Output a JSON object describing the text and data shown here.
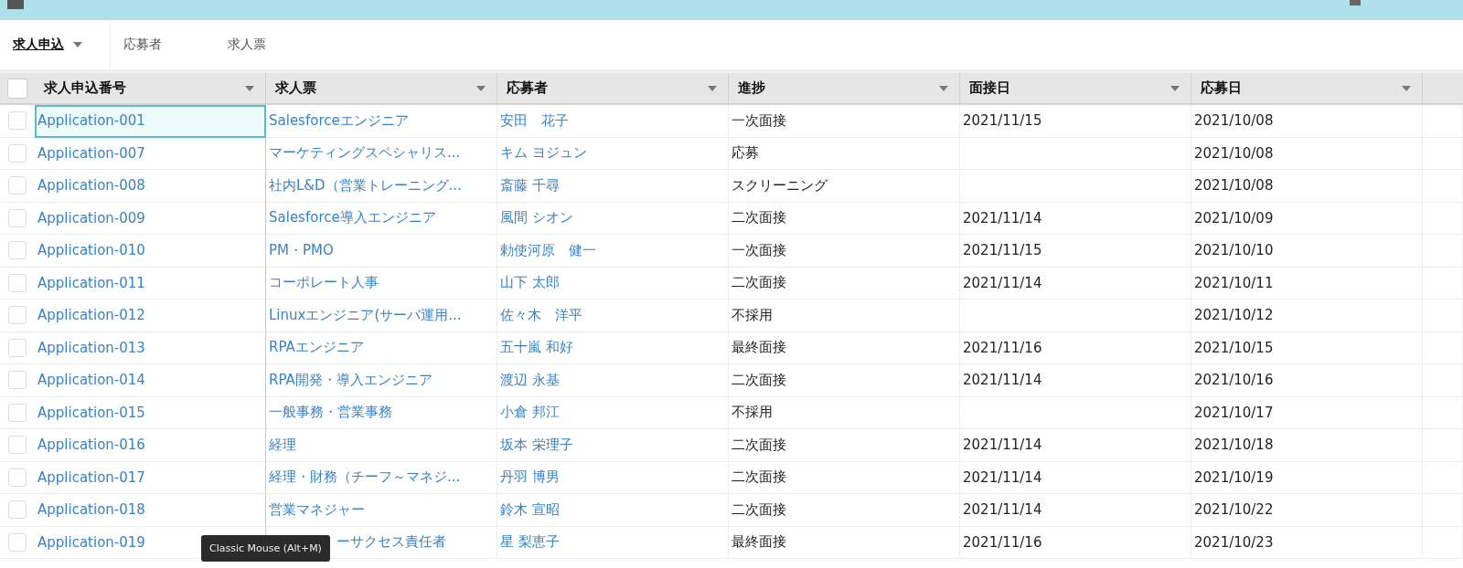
{
  "tabs": [
    {
      "label": "求人申込",
      "selected": true,
      "has_menu": true
    },
    {
      "label": "応募者",
      "selected": false,
      "has_menu": false
    },
    {
      "label": "求人票",
      "selected": false,
      "has_menu": false
    }
  ],
  "table": {
    "select_all_checked": false,
    "columns": [
      "求人申込番号",
      "求人票",
      "応募者",
      "進捗",
      "面接日",
      "応募日"
    ],
    "rows": [
      {
        "checked": false,
        "id": "Application-001",
        "job": "Salesforceエンジニア",
        "applicant": "安田　花子",
        "progress": "一次面接",
        "interview": "2021/11/15",
        "applied": "2021/10/08",
        "focused": true
      },
      {
        "checked": false,
        "id": "Application-007",
        "job": "マーケティングスペシャリス...",
        "applicant": "キム ヨジュン",
        "progress": "応募",
        "applied": "2021/10/08",
        "focused": false
      },
      {
        "checked": false,
        "id": "Application-008",
        "job": "社内L&D（営業トレーニング...",
        "applicant": "斎藤 千尋",
        "progress": "スクリーニング",
        "applied": "2021/10/08",
        "focused": false
      },
      {
        "checked": false,
        "id": "Application-009",
        "job": "Salesforce導入エンジニア",
        "applicant": "風間 シオン",
        "progress": "二次面接",
        "interview": "2021/11/14",
        "applied": "2021/10/09",
        "focused": false
      },
      {
        "checked": false,
        "id": "Application-010",
        "job": "PM・PMO",
        "applicant": "勅使河原　健一",
        "progress": "一次面接",
        "interview": "2021/11/15",
        "applied": "2021/10/10",
        "focused": false
      },
      {
        "checked": false,
        "id": "Application-011",
        "job": "コーポレート人事",
        "applicant": "山下 太郎",
        "progress": "二次面接",
        "interview": "2021/11/14",
        "applied": "2021/10/11",
        "focused": false
      },
      {
        "checked": false,
        "id": "Application-012",
        "job": "Linuxエンジニア(サーバ運用...",
        "applicant": "佐々木　洋平",
        "progress": "不採用",
        "applied": "2021/10/12",
        "focused": false
      },
      {
        "checked": false,
        "id": "Application-013",
        "job": "RPAエンジニア",
        "applicant": "五十嵐 和好",
        "progress": "最終面接",
        "interview": "2021/11/16",
        "applied": "2021/10/15",
        "focused": false
      },
      {
        "checked": false,
        "id": "Application-014",
        "job": "RPA開発・導入エンジニア",
        "applicant": "渡辺 永基",
        "progress": "二次面接",
        "interview": "2021/11/14",
        "applied": "2021/10/16",
        "focused": false
      },
      {
        "checked": false,
        "id": "Application-015",
        "job": "一般事務・営業事務",
        "applicant": "小倉 邦江",
        "progress": "不採用",
        "applied": "2021/10/17",
        "focused": false
      },
      {
        "checked": false,
        "id": "Application-016",
        "job": "経理",
        "applicant": "坂本 栄理子",
        "progress": "二次面接",
        "interview": "2021/11/14",
        "applied": "2021/10/18",
        "focused": false
      },
      {
        "checked": false,
        "id": "Application-017",
        "job": "経理・財務（チーフ～マネジ...",
        "applicant": "丹羽 博男",
        "progress": "二次面接",
        "interview": "2021/11/14",
        "applied": "2021/10/19",
        "focused": false
      },
      {
        "checked": false,
        "id": "Application-018",
        "job": "営業マネジャー",
        "applicant": "鈴木 宣昭",
        "progress": "二次面接",
        "interview": "2021/11/14",
        "applied": "2021/10/22",
        "focused": false
      },
      {
        "checked": false,
        "id": "Application-019",
        "job": "ーサクセス責任者",
        "applicant": "星 梨恵子",
        "progress": "最終面接",
        "interview": "2021/11/16",
        "applied": "2021/10/23",
        "focused": false,
        "tooltip": "Classic Mouse (Alt+M)"
      }
    ]
  }
}
